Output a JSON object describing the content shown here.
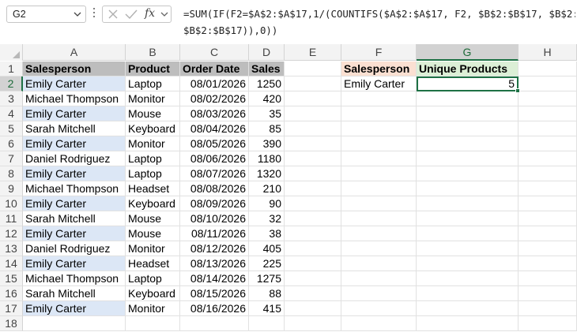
{
  "name_box": "G2",
  "formula_bar": {
    "fx_label": "fx",
    "formula_line1": "=SUM(IF(F2=$A$2:$A$17,1/(COUNTIFS($A$2:$A$17, F2, $B$2:$B$17, $B$2:$B$17)),0))",
    "formula_line2": "$B$2:$B$17)),0))"
  },
  "columns": [
    "A",
    "B",
    "C",
    "D",
    "E",
    "F",
    "G",
    "H"
  ],
  "selected_column": "G",
  "rows": [
    "1",
    "2",
    "3",
    "4",
    "5",
    "6",
    "7",
    "8",
    "9",
    "10",
    "11",
    "12",
    "13",
    "14",
    "15",
    "16",
    "17",
    "18"
  ],
  "selected_row": "2",
  "table": {
    "headers": [
      "Salesperson",
      "Product",
      "Order Date",
      "Sales"
    ],
    "records": [
      [
        "Emily Carter",
        "Laptop",
        "08/01/2026",
        "1250"
      ],
      [
        "Michael Thompson",
        "Monitor",
        "08/02/2026",
        "420"
      ],
      [
        "Emily Carter",
        "Mouse",
        "08/03/2026",
        "35"
      ],
      [
        "Sarah Mitchell",
        "Keyboard",
        "08/04/2026",
        "85"
      ],
      [
        "Emily Carter",
        "Monitor",
        "08/05/2026",
        "390"
      ],
      [
        "Daniel Rodriguez",
        "Laptop",
        "08/06/2026",
        "1180"
      ],
      [
        "Emily Carter",
        "Laptop",
        "08/07/2026",
        "1320"
      ],
      [
        "Michael Thompson",
        "Headset",
        "08/08/2026",
        "210"
      ],
      [
        "Emily Carter",
        "Keyboard",
        "08/09/2026",
        "90"
      ],
      [
        "Sarah Mitchell",
        "Mouse",
        "08/10/2026",
        "32"
      ],
      [
        "Emily Carter",
        "Mouse",
        "08/11/2026",
        "38"
      ],
      [
        "Daniel Rodriguez",
        "Monitor",
        "08/12/2026",
        "405"
      ],
      [
        "Emily Carter",
        "Headset",
        "08/13/2026",
        "225"
      ],
      [
        "Michael Thompson",
        "Laptop",
        "08/14/2026",
        "1275"
      ],
      [
        "Sarah Mitchell",
        "Keyboard",
        "08/15/2026",
        "88"
      ],
      [
        "Emily Carter",
        "Monitor",
        "08/16/2026",
        "415"
      ]
    ]
  },
  "lookup": {
    "header_salesperson": "Salesperson",
    "header_unique": "Unique Products",
    "salesperson": "Emily Carter",
    "unique_products": "5"
  },
  "colors": {
    "highlight_blue": "#dce7f6",
    "header_gray": "#bdbdbd",
    "peach": "#fbe0d2",
    "green": "#dcefd6",
    "selection_green": "#1e7145"
  }
}
